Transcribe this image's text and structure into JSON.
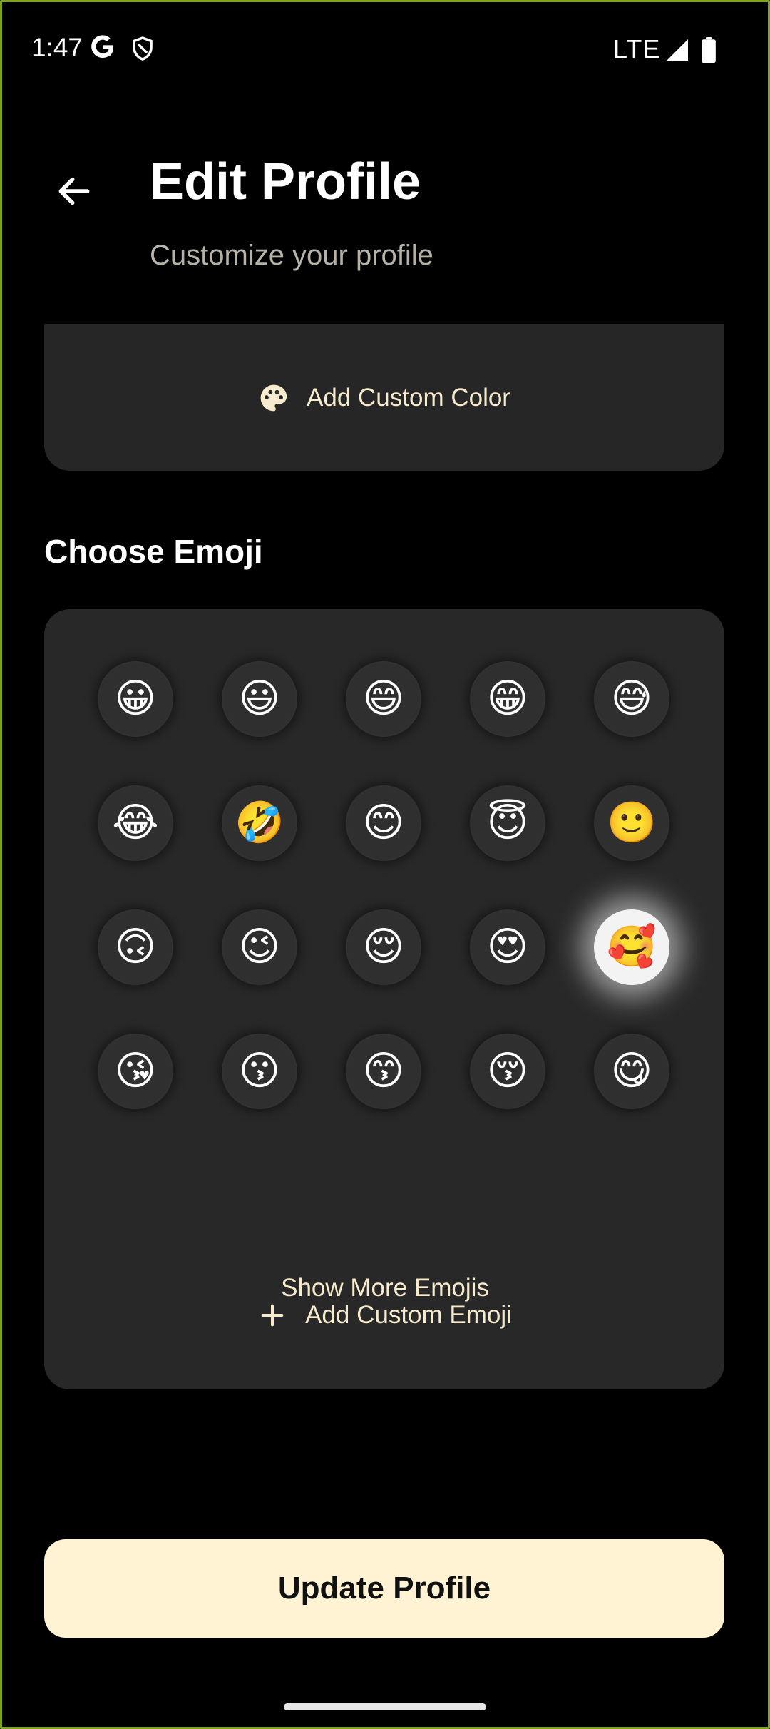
{
  "status_bar": {
    "time": "1:47",
    "network": "LTE",
    "icons": [
      "google-icon",
      "shield-icon",
      "signal-icon",
      "battery-icon"
    ]
  },
  "header": {
    "title": "Edit Profile",
    "subtitle": "Customize your profile",
    "back_icon": "arrow-left-icon"
  },
  "color_section": {
    "add_custom_color_label": "Add Custom Color",
    "icon": "palette-icon"
  },
  "emoji_section": {
    "title": "Choose Emoji",
    "emojis": [
      {
        "char": "😀",
        "selected": false
      },
      {
        "char": "😃",
        "selected": false
      },
      {
        "char": "😄",
        "selected": false
      },
      {
        "char": "😁",
        "selected": false
      },
      {
        "char": "😅",
        "selected": false
      },
      {
        "char": "😂",
        "selected": false
      },
      {
        "char": "🤣",
        "selected": false
      },
      {
        "char": "😊",
        "selected": false
      },
      {
        "char": "😇",
        "selected": false
      },
      {
        "char": "🙂",
        "selected": false
      },
      {
        "char": "🙃",
        "selected": false
      },
      {
        "char": "😉",
        "selected": false
      },
      {
        "char": "😌",
        "selected": false
      },
      {
        "char": "😍",
        "selected": false
      },
      {
        "char": "🥰",
        "selected": true
      },
      {
        "char": "😘",
        "selected": false
      },
      {
        "char": "😗",
        "selected": false
      },
      {
        "char": "😙",
        "selected": false
      },
      {
        "char": "😚",
        "selected": false
      },
      {
        "char": "😋",
        "selected": false
      }
    ],
    "show_more_label": "Show More Emojis",
    "add_custom_emoji_label": "Add Custom Emoji"
  },
  "update_button_label": "Update Profile",
  "colors": {
    "background": "#000000",
    "card": "#282828",
    "accent": "#fff3d3",
    "accent_text": "#f6ebcd",
    "subtitle": "#b7b2a8"
  }
}
